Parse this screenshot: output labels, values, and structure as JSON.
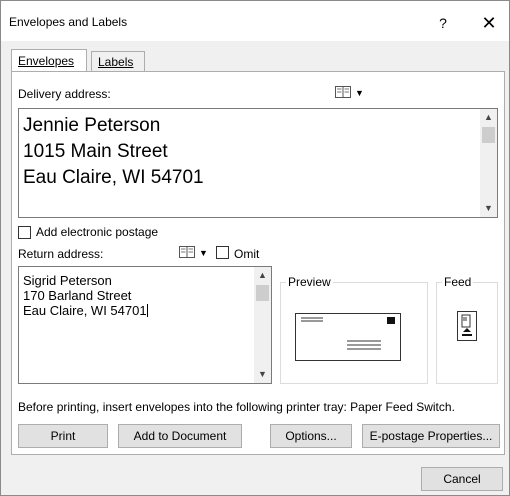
{
  "window": {
    "title": "Envelopes and Labels",
    "help_glyph": "?",
    "close_glyph": "✕"
  },
  "tabs": [
    {
      "label": "Envelopes",
      "active": true
    },
    {
      "label": "Labels",
      "active": false
    }
  ],
  "delivery": {
    "label": "Delivery address:",
    "lines": [
      "Jennie Peterson",
      "1015 Main Street",
      "Eau Claire, WI 54701"
    ]
  },
  "postage": {
    "label": "Add electronic postage",
    "checked": false
  },
  "return": {
    "label": "Return address:",
    "omit_label": "Omit",
    "omit_checked": false,
    "lines": [
      "Sigrid Peterson",
      "170 Barland Street",
      "Eau Claire, WI 54701"
    ]
  },
  "preview": {
    "label": "Preview"
  },
  "feed": {
    "label": "Feed"
  },
  "printer_note": "Before printing, insert envelopes into the following printer tray: Paper Feed Switch.",
  "buttons": {
    "print": "Print",
    "add_to_document": "Add to Document",
    "options": "Options...",
    "epostage": "E-postage Properties...",
    "cancel": "Cancel"
  },
  "icons": {
    "address_book": "address-book-icon",
    "dropdown": "▼",
    "scroll_up": "▲",
    "scroll_down": "▼"
  }
}
